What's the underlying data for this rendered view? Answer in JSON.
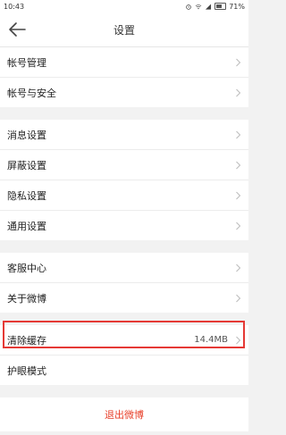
{
  "status_bar": {
    "time": "10:43",
    "battery": "71%",
    "icons": [
      "alarm-icon",
      "wifi-icon",
      "signal-icon",
      "battery-icon"
    ]
  },
  "nav": {
    "title": "设置",
    "back_icon": "arrow-left-icon"
  },
  "groups": [
    {
      "rows": [
        {
          "label": "帐号管理"
        },
        {
          "label": "帐号与安全"
        }
      ]
    },
    {
      "rows": [
        {
          "label": "消息设置"
        },
        {
          "label": "屏蔽设置"
        },
        {
          "label": "隐私设置"
        },
        {
          "label": "通用设置"
        }
      ]
    },
    {
      "rows": [
        {
          "label": "客服中心"
        },
        {
          "label": "关于微博"
        }
      ]
    },
    {
      "rows": [
        {
          "label": "清除缓存",
          "value": "14.4MB"
        },
        {
          "label": "护眼模式"
        }
      ]
    }
  ],
  "logout": {
    "label": "退出微博"
  },
  "colors": {
    "highlight": "#e53935",
    "logout_text": "#e8412b",
    "background": "#f2f2f2"
  }
}
